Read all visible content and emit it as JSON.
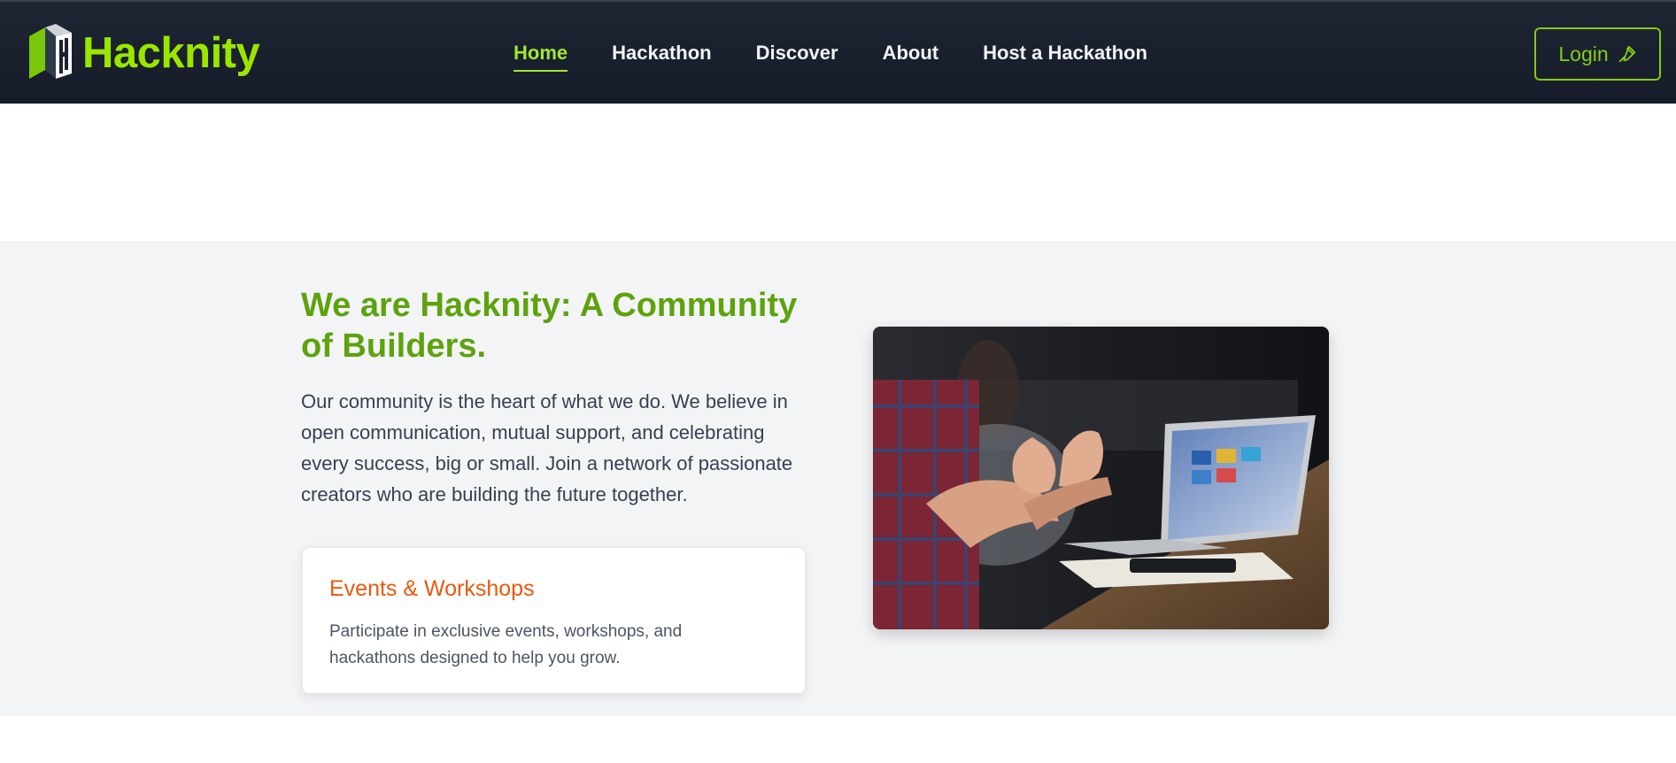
{
  "brand": {
    "name": "Hacknity",
    "accent": "#9ae600"
  },
  "nav": {
    "items": [
      {
        "label": "Home",
        "active": true
      },
      {
        "label": "Hackathon",
        "active": false
      },
      {
        "label": "Discover",
        "active": false
      },
      {
        "label": "About",
        "active": false
      },
      {
        "label": "Host a Hackathon",
        "active": false
      }
    ],
    "login_label": "Login",
    "login_icon": "pen-icon"
  },
  "about": {
    "heading": "We are Hacknity: A Community of Builders.",
    "description": "Our community is the heart of what we do. We believe in open communication, mutual support, and celebrating every success, big or small. Join a network of passionate creators who are building the future together.",
    "card": {
      "title": "Events & Workshops",
      "text": "Participate in exclusive events, workshops, and hackathons designed to help you grow."
    }
  },
  "colors": {
    "navbar": "#1a202c",
    "heading": "#5ea20e",
    "card_title": "#ea580c",
    "section_bg": "#f3f4f6"
  }
}
